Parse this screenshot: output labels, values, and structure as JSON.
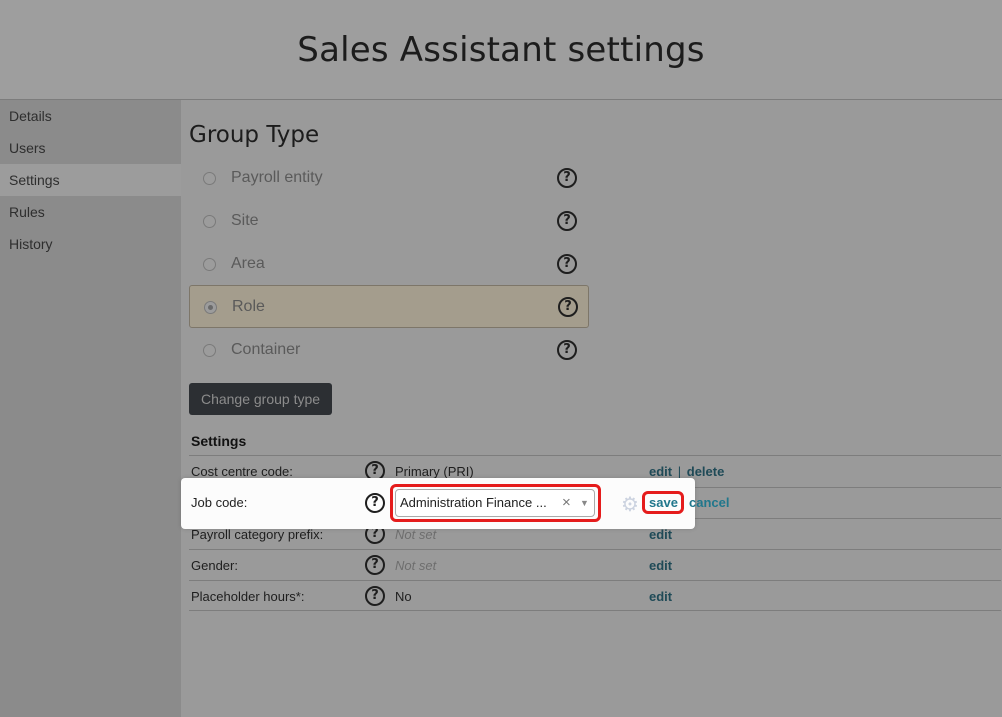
{
  "header": {
    "title": "Sales Assistant settings"
  },
  "sidebar": {
    "items": [
      {
        "label": "Details"
      },
      {
        "label": "Users"
      },
      {
        "label": "Settings"
      },
      {
        "label": "Rules"
      },
      {
        "label": "History"
      }
    ],
    "active": "Settings"
  },
  "group_type": {
    "title": "Group Type",
    "options": [
      {
        "label": "Payroll entity"
      },
      {
        "label": "Site"
      },
      {
        "label": "Area"
      },
      {
        "label": "Role"
      },
      {
        "label": "Container"
      }
    ],
    "selected": "Role",
    "help_symbol": "?",
    "change_button_label": "Change group type"
  },
  "settings": {
    "heading": "Settings",
    "rows": [
      {
        "label": "Cost centre code:",
        "value": "Primary (PRI)",
        "edit": "edit",
        "sep": "|",
        "delete": "delete"
      },
      {
        "label": "Job code:",
        "select_value": "Administration Finance ...",
        "clear_symbol": "×",
        "arrow_symbol": "▼",
        "save": "save",
        "cancel": "cancel"
      },
      {
        "label": "Payroll category prefix:",
        "value": "Not set",
        "edit": "edit"
      },
      {
        "label": "Gender:",
        "value": "Not set",
        "edit": "edit"
      },
      {
        "label": "Placeholder hours*:",
        "value": "No",
        "edit": "edit"
      }
    ]
  },
  "icons": {
    "help": "help-icon",
    "gear": "gear-icon"
  },
  "colors": {
    "highlight": "#e51c1c",
    "link": "#21778c",
    "button_bg": "#2c2f33"
  }
}
